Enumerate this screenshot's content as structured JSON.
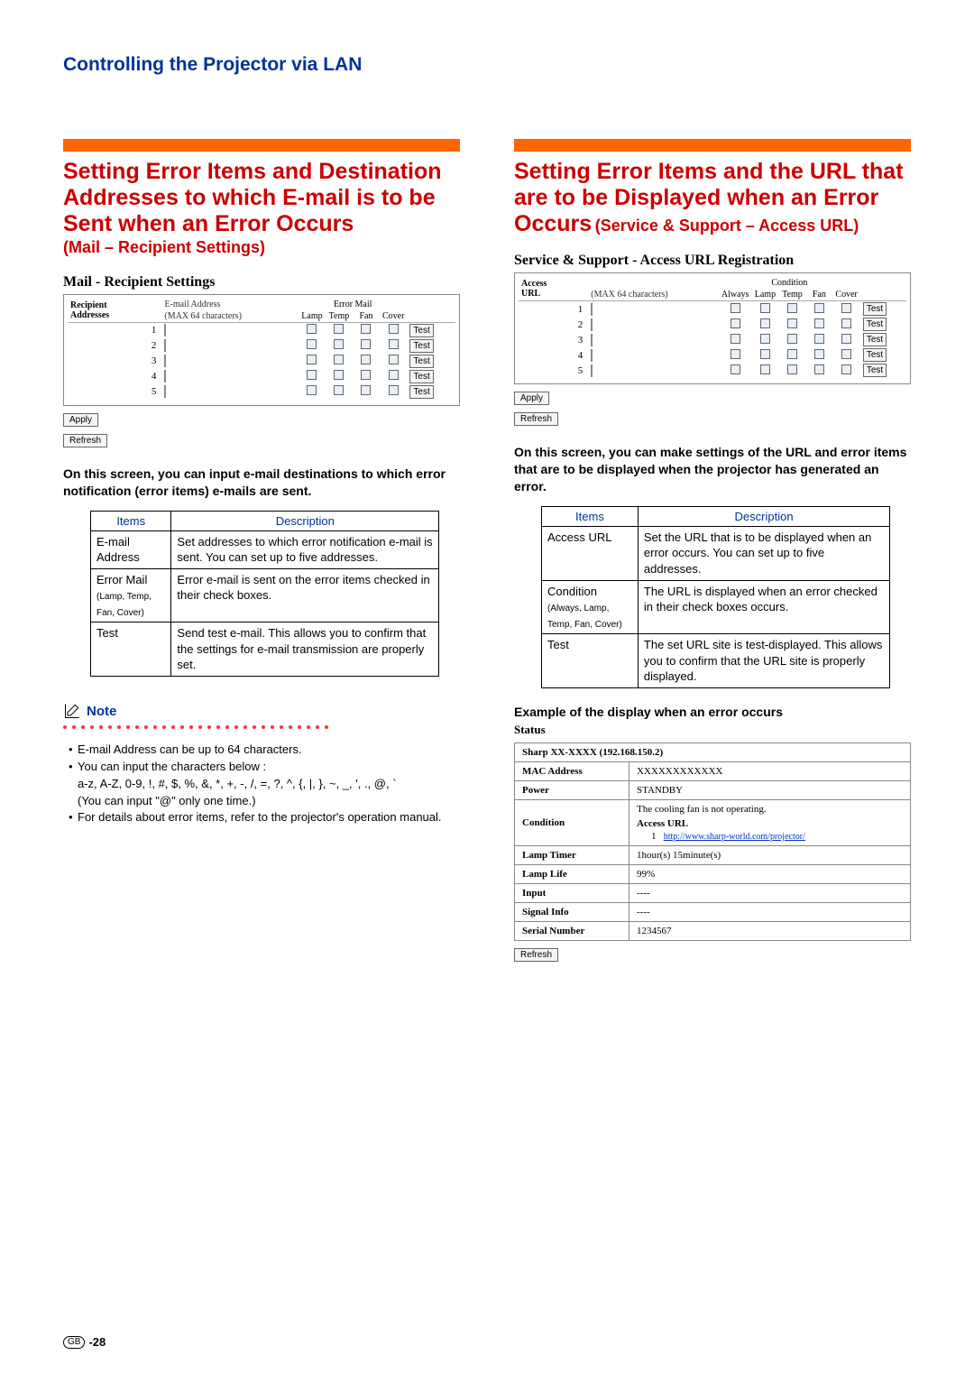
{
  "page_title": "Controlling the Projector via LAN",
  "page_number": "-28",
  "gb_label": "GB",
  "left": {
    "heading": "Setting Error Items and Destination Addresses to which E-mail is to be Sent when an Error Occurs",
    "subheading": "(Mail – Recipient Settings)",
    "panel_title": "Mail - Recipient Settings",
    "col_recipient": "Recipient\nAddresses",
    "col_email": "E-mail Address",
    "col_max": "(MAX 64 characters)",
    "col_errormail": "Error Mail",
    "chk_headers": [
      "Lamp",
      "Temp",
      "Fan",
      "Cover"
    ],
    "rows": [
      "1",
      "2",
      "3",
      "4",
      "5"
    ],
    "test_label": "Test",
    "apply": "Apply",
    "refresh": "Refresh",
    "desc": "On this screen, you can input e-mail destinations to which error notification (error items) e-mails are sent.",
    "table_h1": "Items",
    "table_h2": "Description",
    "t1_r1_c1": "E-mail Address",
    "t1_r1_c2": "Set addresses to which error notification e-mail is sent. You can set up to five addresses.",
    "t1_r2_c1a": "Error Mail",
    "t1_r2_c1b": "(Lamp, Temp, Fan, Cover)",
    "t1_r2_c2": "Error e-mail is sent on the error items checked in their check boxes.",
    "t1_r3_c1": "Test",
    "t1_r3_c2": "Send test e-mail. This allows you to confirm that the settings for e-mail transmission are properly set.",
    "note_label": "Note",
    "notes": [
      "E-mail Address can be up to 64 characters.",
      "You can input the characters below :\na-z, A-Z, 0-9, !, #, $, %, &, *, +, -, /, =, ?, ^, {, |, }, ~, _, ', ., @, `\n(You can input \"@\" only one time.)",
      "For details about error items, refer to the projector's operation manual."
    ]
  },
  "right": {
    "heading_a": "Setting Error Items and the URL that are to be Displayed when an Error Occurs",
    "heading_b": "(Service & Support – Access URL)",
    "panel_title": "Service & Support - Access URL Registration",
    "col_access": "Access\nURL",
    "col_max": "(MAX 64 characters)",
    "col_condition": "Condition",
    "chk_headers": [
      "Always",
      "Lamp",
      "Temp",
      "Fan",
      "Cover"
    ],
    "rows": [
      "1",
      "2",
      "3",
      "4",
      "5"
    ],
    "test_label": "Test",
    "apply": "Apply",
    "refresh": "Refresh",
    "desc": "On this screen, you can make settings of the URL and error items that are to be displayed when the projector has generated an error.",
    "table_h1": "Items",
    "table_h2": "Description",
    "t2_r1_c1": "Access URL",
    "t2_r1_c2": "Set the URL that is to be displayed when an error occurs. You can set up to five addresses.",
    "t2_r2_c1a": "Condition",
    "t2_r2_c1b": "(Always, Lamp, Temp, Fan, Cover)",
    "t2_r2_c2": "The URL is displayed when an error checked in their check boxes occurs.",
    "t2_r3_c1": "Test",
    "t2_r3_c2": "The set URL site is test-displayed. This allows you to confirm that the URL site is properly displayed.",
    "example_heading": "Example of the display when an error occurs",
    "status_heading": "Status",
    "status_title": "Sharp XX-XXXX   (192.168.150.2)",
    "status": [
      {
        "label": "MAC Address",
        "value": "XXXXXXXXXXXX"
      },
      {
        "label": "Power",
        "value": "STANDBY"
      }
    ],
    "condition_label": "Condition",
    "condition_line1": "The cooling fan is not operating.",
    "condition_line2": "Access URL",
    "condition_link_num": "1",
    "condition_link": "http://www.sharp-world.com/projector/",
    "status2": [
      {
        "label": "Lamp Timer",
        "value": "1hour(s) 15minute(s)"
      },
      {
        "label": "Lamp Life",
        "value": "99%"
      },
      {
        "label": "Input",
        "value": "----"
      },
      {
        "label": "Signal Info",
        "value": "----"
      },
      {
        "label": "Serial Number",
        "value": "1234567"
      }
    ],
    "status_refresh": "Refresh"
  }
}
